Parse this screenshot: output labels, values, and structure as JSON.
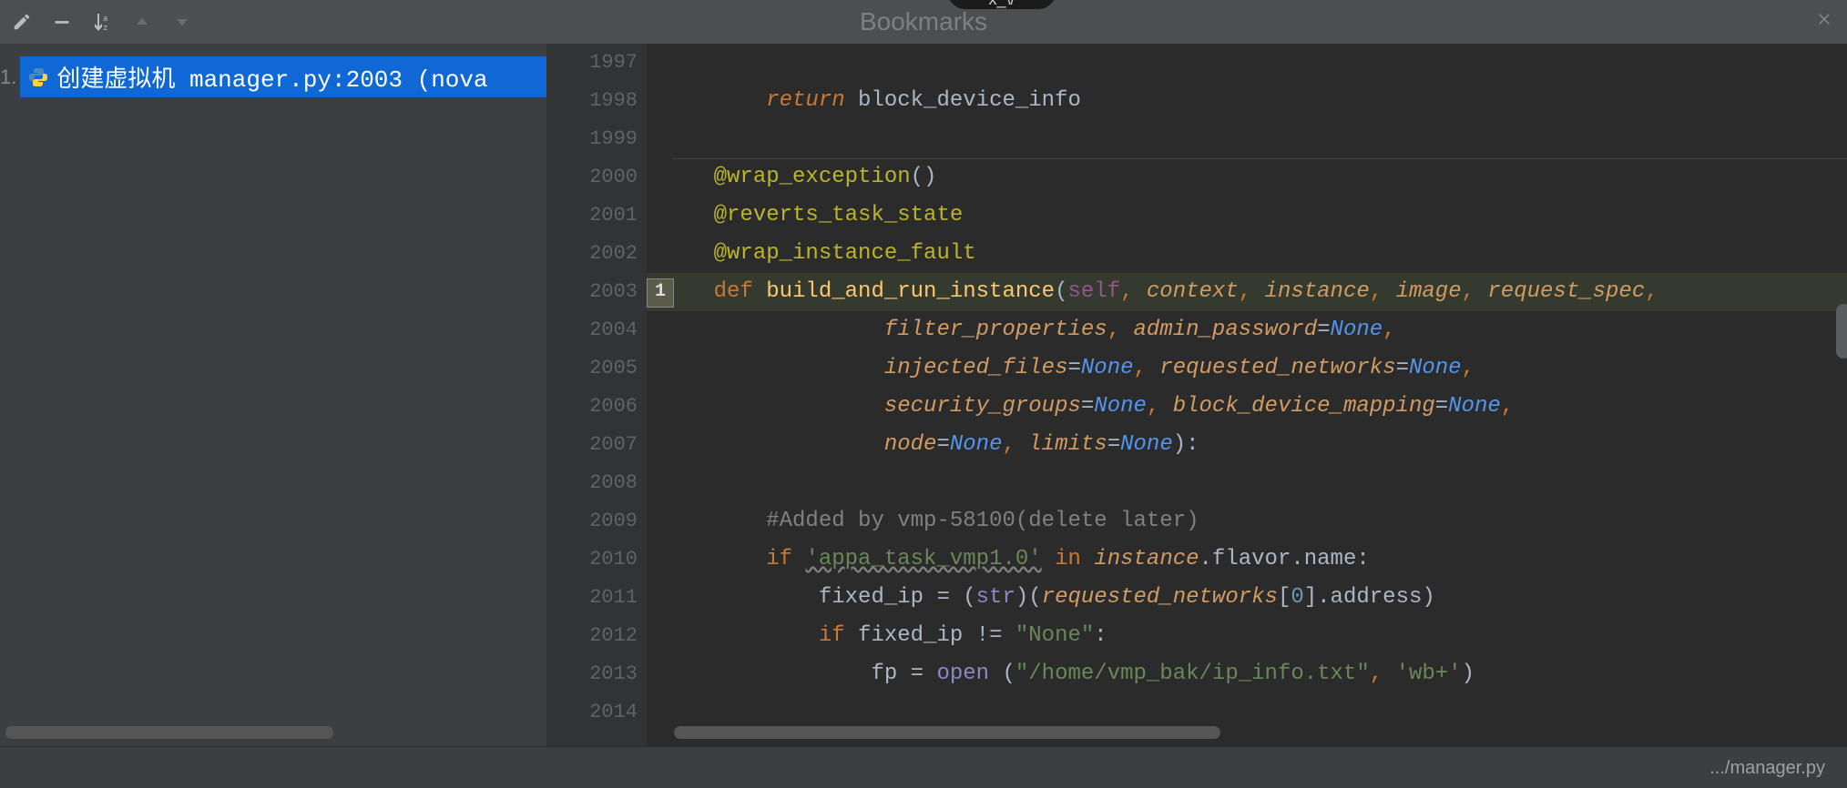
{
  "header": {
    "title": "Bookmarks",
    "tab_overlay": "x_\\/"
  },
  "bookmarks": {
    "items": [
      {
        "index": "1.",
        "label": "创建虚拟机 manager.py:2003 (nova"
      }
    ]
  },
  "editor": {
    "bookmark_marker": "1",
    "status_path": ".../manager.py",
    "lines": [
      {
        "n": "1997",
        "tokens": []
      },
      {
        "n": "1998",
        "tokens": [
          {
            "t": "        ",
            "c": ""
          },
          {
            "t": "return",
            "c": "c-kw"
          },
          {
            "t": " block_device_info",
            "c": "c-default"
          }
        ]
      },
      {
        "n": "1999",
        "tokens": []
      },
      {
        "n": "2000",
        "tokens": [
          {
            "t": "    ",
            "c": ""
          },
          {
            "t": "@wrap_exception",
            "c": "c-dec"
          },
          {
            "t": "()",
            "c": "c-default"
          }
        ]
      },
      {
        "n": "2001",
        "tokens": [
          {
            "t": "    ",
            "c": ""
          },
          {
            "t": "@reverts_task_state",
            "c": "c-dec"
          }
        ]
      },
      {
        "n": "2002",
        "tokens": [
          {
            "t": "    ",
            "c": ""
          },
          {
            "t": "@wrap_instance_fault",
            "c": "c-dec"
          }
        ]
      },
      {
        "n": "2003",
        "hl": true,
        "tokens": [
          {
            "t": "    ",
            "c": ""
          },
          {
            "t": "def ",
            "c": "c-kw2"
          },
          {
            "t": "build_and_run_instance",
            "c": "c-fn"
          },
          {
            "t": "(",
            "c": "c-default"
          },
          {
            "t": "self",
            "c": "c-self"
          },
          {
            "t": ", ",
            "c": "c-kw2"
          },
          {
            "t": "context",
            "c": "c-param"
          },
          {
            "t": ", ",
            "c": "c-kw2"
          },
          {
            "t": "instance",
            "c": "c-param"
          },
          {
            "t": ", ",
            "c": "c-kw2"
          },
          {
            "t": "image",
            "c": "c-param"
          },
          {
            "t": ", ",
            "c": "c-kw2"
          },
          {
            "t": "request_spec",
            "c": "c-param"
          },
          {
            "t": ",",
            "c": "c-kw2"
          }
        ]
      },
      {
        "n": "2004",
        "tokens": [
          {
            "t": "                 ",
            "c": ""
          },
          {
            "t": "filter_properties",
            "c": "c-param"
          },
          {
            "t": ", ",
            "c": "c-kw2"
          },
          {
            "t": "admin_password",
            "c": "c-param"
          },
          {
            "t": "=",
            "c": "c-default"
          },
          {
            "t": "None",
            "c": "c-none"
          },
          {
            "t": ",",
            "c": "c-kw2"
          }
        ]
      },
      {
        "n": "2005",
        "tokens": [
          {
            "t": "                 ",
            "c": ""
          },
          {
            "t": "injected_files",
            "c": "c-param"
          },
          {
            "t": "=",
            "c": "c-default"
          },
          {
            "t": "None",
            "c": "c-none"
          },
          {
            "t": ", ",
            "c": "c-kw2"
          },
          {
            "t": "requested_networks",
            "c": "c-param"
          },
          {
            "t": "=",
            "c": "c-default"
          },
          {
            "t": "None",
            "c": "c-none"
          },
          {
            "t": ",",
            "c": "c-kw2"
          }
        ]
      },
      {
        "n": "2006",
        "tokens": [
          {
            "t": "                 ",
            "c": ""
          },
          {
            "t": "security_groups",
            "c": "c-param"
          },
          {
            "t": "=",
            "c": "c-default"
          },
          {
            "t": "None",
            "c": "c-none"
          },
          {
            "t": ", ",
            "c": "c-kw2"
          },
          {
            "t": "block_device_mapping",
            "c": "c-param"
          },
          {
            "t": "=",
            "c": "c-default"
          },
          {
            "t": "None",
            "c": "c-none"
          },
          {
            "t": ",",
            "c": "c-kw2"
          }
        ]
      },
      {
        "n": "2007",
        "tokens": [
          {
            "t": "                 ",
            "c": ""
          },
          {
            "t": "node",
            "c": "c-param"
          },
          {
            "t": "=",
            "c": "c-default"
          },
          {
            "t": "None",
            "c": "c-none"
          },
          {
            "t": ", ",
            "c": "c-kw2"
          },
          {
            "t": "limits",
            "c": "c-param"
          },
          {
            "t": "=",
            "c": "c-default"
          },
          {
            "t": "None",
            "c": "c-none"
          },
          {
            "t": "):",
            "c": "c-default"
          }
        ]
      },
      {
        "n": "2008",
        "tokens": []
      },
      {
        "n": "2009",
        "tokens": [
          {
            "t": "        ",
            "c": ""
          },
          {
            "t": "#Added by vmp-58100(delete later)",
            "c": "c-com"
          }
        ]
      },
      {
        "n": "2010",
        "tokens": [
          {
            "t": "        ",
            "c": ""
          },
          {
            "t": "if ",
            "c": "c-kw2"
          },
          {
            "t": "'appa_task_vmp1.0'",
            "c": "c-str underline-wave"
          },
          {
            "t": " ",
            "c": ""
          },
          {
            "t": "in",
            "c": "c-kw2"
          },
          {
            "t": " ",
            "c": ""
          },
          {
            "t": "instance",
            "c": "c-param"
          },
          {
            "t": ".flavor.name:",
            "c": "c-default"
          }
        ]
      },
      {
        "n": "2011",
        "tokens": [
          {
            "t": "            fixed_ip = (",
            "c": "c-default"
          },
          {
            "t": "str",
            "c": "c-builtin"
          },
          {
            "t": ")(",
            "c": "c-default"
          },
          {
            "t": "requested_networks",
            "c": "c-param"
          },
          {
            "t": "[",
            "c": "c-default"
          },
          {
            "t": "0",
            "c": "c-num"
          },
          {
            "t": "].address)",
            "c": "c-default"
          }
        ]
      },
      {
        "n": "2012",
        "tokens": [
          {
            "t": "            ",
            "c": ""
          },
          {
            "t": "if",
            "c": "c-kw2"
          },
          {
            "t": " fixed_ip != ",
            "c": "c-default"
          },
          {
            "t": "\"None\"",
            "c": "c-str"
          },
          {
            "t": ":",
            "c": "c-default"
          }
        ]
      },
      {
        "n": "2013",
        "tokens": [
          {
            "t": "                fp = ",
            "c": "c-default"
          },
          {
            "t": "open",
            "c": "c-builtin"
          },
          {
            "t": " (",
            "c": "c-default"
          },
          {
            "t": "\"/home/vmp_bak/ip_info.txt\"",
            "c": "c-str"
          },
          {
            "t": ", ",
            "c": "c-kw2"
          },
          {
            "t": "'wb+'",
            "c": "c-str"
          },
          {
            "t": ")",
            "c": "c-default"
          }
        ]
      },
      {
        "n": "2014",
        "tokens": [
          {
            "t": "                ",
            "c": ""
          }
        ]
      }
    ]
  }
}
